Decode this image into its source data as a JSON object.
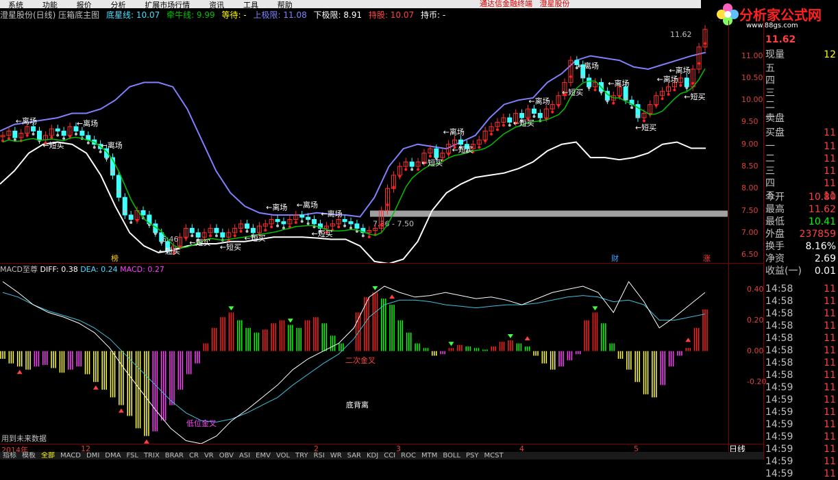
{
  "menubar": {
    "items": [
      "系统",
      "功能",
      "报价",
      "分析",
      "扩展市场行情",
      "资讯",
      "工具",
      "帮助"
    ],
    "center_text": "通达信金融终端",
    "center_stock": "澄星股份"
  },
  "brand": {
    "logo": "分析家公式网",
    "url_text": "www.88gs.com"
  },
  "infobar": {
    "stock": "澄星股份(日线) 压箱底主图",
    "items": [
      {
        "label": "底星线: 10.07",
        "color": "#40e0ff"
      },
      {
        "label": "牵牛线: 9.99",
        "color": "#00c000"
      },
      {
        "label": "等待: -",
        "color": "#ffff00"
      },
      {
        "label": "上极限: 11.08",
        "color": "#8080ff"
      },
      {
        "label": "下极限: 8.91",
        "color": "#ffffff"
      },
      {
        "label": "持股: 10.07",
        "color": "#ff4040"
      },
      {
        "label": "持币: -",
        "color": "#ffffff"
      }
    ]
  },
  "main_chart": {
    "yticks": [
      "11.00",
      "10.50",
      "10.00",
      "9.50",
      "9.00",
      "8.50",
      "8.00",
      "7.50",
      "7.00",
      "6.50"
    ],
    "ymin": 6.3,
    "ymax": 11.8,
    "high_label": "11.62",
    "low_label": "6.46",
    "range_label": "7.36 - 7.50",
    "event_labels": [
      "榜",
      "财",
      "涨"
    ],
    "leave_label": "←离场",
    "short_label": "←短买",
    "candles": [
      9.2,
      9.3,
      9.15,
      9.25,
      9.4,
      9.3,
      9.1,
      9.2,
      9.35,
      9.3,
      9.2,
      9.4,
      9.3,
      9.2,
      9.1,
      9.0,
      8.9,
      8.7,
      8.3,
      7.8,
      7.4,
      7.3,
      7.5,
      7.4,
      7.2,
      7.0,
      6.8,
      6.6,
      6.7,
      6.9,
      7.1,
      7.0,
      6.9,
      7.0,
      7.1,
      7.0,
      6.9,
      7.0,
      7.1,
      7.2,
      7.1,
      7.0,
      7.15,
      7.2,
      7.3,
      7.25,
      7.2,
      7.3,
      7.4,
      7.35,
      7.3,
      7.2,
      7.1,
      7.15,
      7.2,
      7.3,
      7.25,
      7.2,
      7.1,
      7.0,
      7.05,
      7.1,
      7.5,
      8.0,
      8.3,
      8.5,
      8.6,
      8.5,
      8.6,
      8.8,
      8.9,
      8.7,
      8.8,
      9.0,
      9.1,
      9.0,
      8.9,
      9.0,
      9.1,
      9.3,
      9.4,
      9.5,
      9.6,
      9.5,
      9.7,
      9.6,
      9.8,
      9.7,
      9.6,
      9.8,
      9.9,
      10.1,
      10.4,
      10.9,
      10.8,
      10.5,
      10.3,
      10.4,
      10.2,
      10.0,
      10.1,
      10.3,
      10.0,
      9.9,
      9.6,
      9.7,
      9.9,
      10.1,
      10.2,
      10.3,
      10.4,
      10.5,
      10.3,
      10.7,
      11.2,
      11.6
    ],
    "upper_band": [
      9.3,
      9.45,
      9.5,
      9.55,
      9.6,
      9.7,
      9.7,
      9.8,
      10.0,
      10.3,
      10.4,
      10.4,
      10.3,
      9.8,
      9.1,
      8.4,
      7.9,
      7.6,
      7.45,
      7.4,
      7.4,
      7.4,
      7.45,
      7.42,
      7.4,
      7.36,
      7.8,
      8.5,
      8.9,
      9.0,
      8.95,
      8.9,
      9.05,
      9.2,
      9.6,
      9.9,
      10.0,
      10.05,
      10.4,
      10.6,
      10.9,
      11.0,
      10.95,
      10.9,
      10.75,
      10.7,
      10.8,
      10.9,
      11.0,
      11.08
    ],
    "lower_band": [
      8.1,
      8.4,
      8.8,
      9.0,
      9.05,
      9.0,
      8.8,
      8.3,
      7.6,
      7.0,
      6.7,
      6.55,
      6.6,
      6.7,
      6.75,
      6.75,
      6.8,
      6.8,
      6.85,
      6.9,
      6.9,
      6.9,
      6.88,
      6.85,
      6.85,
      6.7,
      6.35,
      6.3,
      6.4,
      6.8,
      7.5,
      7.9,
      8.1,
      8.25,
      8.3,
      8.35,
      8.45,
      8.6,
      8.85,
      9.0,
      9.05,
      8.7,
      8.7,
      8.65,
      8.7,
      8.8,
      9.0,
      9.05,
      8.91,
      8.91
    ]
  },
  "macd": {
    "name": "MACD至尊",
    "diff_label": "DIFF: 0.38",
    "dea_label": "DEA: 0.24",
    "macd_label": "MACD: 0.27",
    "yticks": [
      "0.40",
      "0.20",
      "0.00",
      "-0.20"
    ],
    "ymin": -0.6,
    "ymax": 0.5,
    "annotation_golden_low": "低位金叉",
    "annotation_second_golden": "二次金叉",
    "annotation_bottom_div": "底背离",
    "future_data_note": "用到未来数据",
    "bars": [
      -0.05,
      -0.08,
      -0.1,
      -0.12,
      -0.1,
      -0.09,
      -0.11,
      -0.14,
      -0.12,
      -0.1,
      -0.15,
      -0.2,
      -0.25,
      -0.3,
      -0.35,
      -0.42,
      -0.5,
      -0.55,
      -0.52,
      -0.45,
      -0.35,
      -0.25,
      -0.15,
      -0.08,
      0.05,
      0.15,
      0.22,
      0.25,
      0.2,
      0.15,
      0.12,
      0.14,
      0.18,
      0.2,
      0.17,
      0.15,
      0.2,
      0.22,
      0.18,
      0.1,
      0.05,
      0.0,
      0.25,
      0.35,
      0.38,
      0.34,
      0.3,
      0.2,
      0.12,
      0.05,
      0.02,
      -0.03,
      -0.02,
      0.02,
      0.04,
      0.03,
      0.02,
      0.01,
      0.03,
      0.06,
      0.07,
      0.05,
      0.03,
      -0.03,
      -0.08,
      -0.12,
      -0.1,
      -0.06,
      -0.02,
      0.2,
      0.25,
      0.18,
      0.05,
      -0.05,
      -0.12,
      -0.2,
      -0.28,
      -0.3,
      -0.22,
      -0.1,
      -0.03,
      0.02,
      0.15,
      0.27
    ],
    "diff_line": [
      0.45,
      0.38,
      0.3,
      0.25,
      0.22,
      0.18,
      0.12,
      0.02,
      -0.12,
      -0.25,
      -0.38,
      -0.5,
      -0.58,
      -0.6,
      -0.55,
      -0.45,
      -0.38,
      -0.3,
      -0.22,
      -0.12,
      -0.05,
      0.0,
      0.05,
      0.15,
      0.35,
      0.42,
      0.38,
      0.35,
      0.36,
      0.38,
      0.36,
      0.34,
      0.35,
      0.33,
      0.3,
      0.34,
      0.38,
      0.4,
      0.42,
      0.38,
      0.25,
      0.45,
      0.32,
      0.15,
      0.22,
      0.3,
      0.38
    ],
    "dea_line": [
      0.38,
      0.35,
      0.3,
      0.26,
      0.23,
      0.2,
      0.15,
      0.08,
      -0.02,
      -0.12,
      -0.22,
      -0.32,
      -0.4,
      -0.45,
      -0.46,
      -0.44,
      -0.4,
      -0.35,
      -0.3,
      -0.22,
      -0.15,
      -0.08,
      -0.02,
      0.08,
      0.22,
      0.3,
      0.33,
      0.33,
      0.32,
      0.3,
      0.29,
      0.28,
      0.29,
      0.3,
      0.3,
      0.31,
      0.33,
      0.35,
      0.36,
      0.35,
      0.32,
      0.33,
      0.3,
      0.2,
      0.2,
      0.22,
      0.24
    ]
  },
  "xaxis": {
    "labels": [
      "2014年",
      "12",
      "2",
      "3",
      "4",
      "5"
    ]
  },
  "period": "日线",
  "tabs": [
    "指标",
    "模板",
    "全部",
    "MACD",
    "DMI",
    "DMA",
    "FSL",
    "TRIX",
    "BRAR",
    "CR",
    "VR",
    "OBV",
    "ASI",
    "EMV",
    "VOL",
    "TRY",
    "RSI",
    "WR",
    "SAR",
    "KDJ",
    "CCI",
    "ROC",
    "MTM",
    "BOLL",
    "PSY",
    "MCST"
  ],
  "right_panel": {
    "title_price": "11.62",
    "rows": [
      {
        "label": "现量",
        "value": "12",
        "color": "#ffff00"
      },
      {
        "label": "卖盘",
        "value": "",
        "color": "#c0c0c0"
      },
      {
        "label": "买盘",
        "value": "11",
        "color": "#ff4040"
      },
      {
        "label": "今开",
        "value": "10.80",
        "color": "#ff4040"
      },
      {
        "label": "最高",
        "value": "11.62",
        "color": "#ff4040"
      },
      {
        "label": "最低",
        "value": "10.41",
        "color": "#00ff00"
      },
      {
        "label": "外盘",
        "value": "237859",
        "color": "#ff4040"
      },
      {
        "label": "换手",
        "value": "8.16%",
        "color": "#ffffff"
      },
      {
        "label": "净资",
        "value": "2.69",
        "color": "#ffffff"
      },
      {
        "label": "收益(一)",
        "value": "0.01",
        "color": "#ffffff"
      }
    ],
    "levels": [
      "五",
      "四",
      "三",
      "二",
      "一"
    ],
    "buy_levels": [
      "一",
      "二",
      "三",
      "四",
      "五"
    ],
    "buy_values": [
      "11",
      "11",
      "11",
      "11",
      "11"
    ],
    "trades": [
      {
        "time": "14:58",
        "val": "11"
      },
      {
        "time": "14:58",
        "val": "11"
      },
      {
        "time": "14:58",
        "val": "11"
      },
      {
        "time": "14:58",
        "val": "11"
      },
      {
        "time": "14:58",
        "val": "11"
      },
      {
        "time": "14:58",
        "val": "11"
      },
      {
        "time": "14:58",
        "val": "11"
      },
      {
        "time": "14:58",
        "val": "11"
      },
      {
        "time": "14:59",
        "val": "11"
      },
      {
        "time": "14:59",
        "val": "11"
      },
      {
        "time": "14:59",
        "val": "11"
      },
      {
        "time": "14:59",
        "val": "11"
      },
      {
        "time": "14:59",
        "val": "11"
      },
      {
        "time": "14:59",
        "val": "11"
      },
      {
        "time": "14:59",
        "val": "11"
      },
      {
        "time": "14:59",
        "val": "11"
      }
    ]
  }
}
